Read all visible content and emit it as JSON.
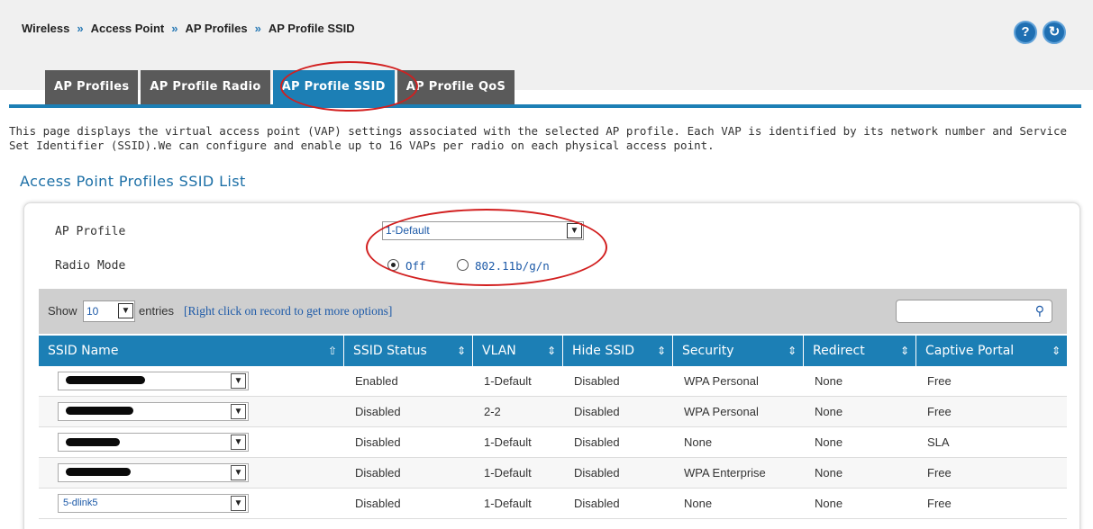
{
  "breadcrumb": {
    "items": [
      "Wireless",
      "Access Point",
      "AP Profiles",
      "AP Profile SSID"
    ],
    "separator": "»"
  },
  "header_icons": [
    "help-icon",
    "refresh-icon"
  ],
  "tabs": [
    {
      "label": "AP Profiles",
      "active": false
    },
    {
      "label": "AP Profile Radio",
      "active": false
    },
    {
      "label": "AP Profile SSID",
      "active": true
    },
    {
      "label": "AP Profile QoS",
      "active": false
    }
  ],
  "description": "This page displays the virtual access point (VAP) settings associated with the selected AP profile. Each VAP is identified by its network number and Service Set Identifier (SSID).We can configure and enable up to 16 VAPs per radio on each physical access point.",
  "section_title": "Access Point Profiles SSID List",
  "form": {
    "ap_profile_label": "AP Profile",
    "ap_profile_value": "1-Default",
    "radio_mode_label": "Radio Mode",
    "radio_options": [
      {
        "label": "Off",
        "checked": true
      },
      {
        "label": "802.11b/g/n",
        "checked": false
      }
    ]
  },
  "table_controls": {
    "show_label": "Show",
    "entries_value": "10",
    "entries_label": "entries",
    "hint": "[Right click on record to get more options]",
    "search_value": ""
  },
  "table": {
    "columns": [
      "SSID Name",
      "SSID Status",
      "VLAN",
      "Hide SSID",
      "Security",
      "Redirect",
      "Captive Portal"
    ],
    "rows": [
      {
        "ssid": "",
        "redacted": true,
        "status": "Enabled",
        "vlan": "1-Default",
        "hide": "Disabled",
        "security": "WPA Personal",
        "redirect": "None",
        "portal": "Free"
      },
      {
        "ssid": "",
        "redacted": true,
        "status": "Disabled",
        "vlan": "2-2",
        "hide": "Disabled",
        "security": "WPA Personal",
        "redirect": "None",
        "portal": "Free"
      },
      {
        "ssid": "",
        "redacted": true,
        "status": "Disabled",
        "vlan": "1-Default",
        "hide": "Disabled",
        "security": "None",
        "redirect": "None",
        "portal": "SLA"
      },
      {
        "ssid": "",
        "redacted": true,
        "status": "Disabled",
        "vlan": "1-Default",
        "hide": "Disabled",
        "security": "WPA Enterprise",
        "redirect": "None",
        "portal": "Free"
      },
      {
        "ssid": "5-dlink5",
        "redacted": false,
        "status": "Disabled",
        "vlan": "1-Default",
        "hide": "Disabled",
        "security": "None",
        "redirect": "None",
        "portal": "Free"
      }
    ]
  },
  "colors": {
    "accent": "#1c7fb5",
    "tab_inactive": "#5a5a5a",
    "annotation": "#d21f1f",
    "link": "#1d5aa8"
  }
}
